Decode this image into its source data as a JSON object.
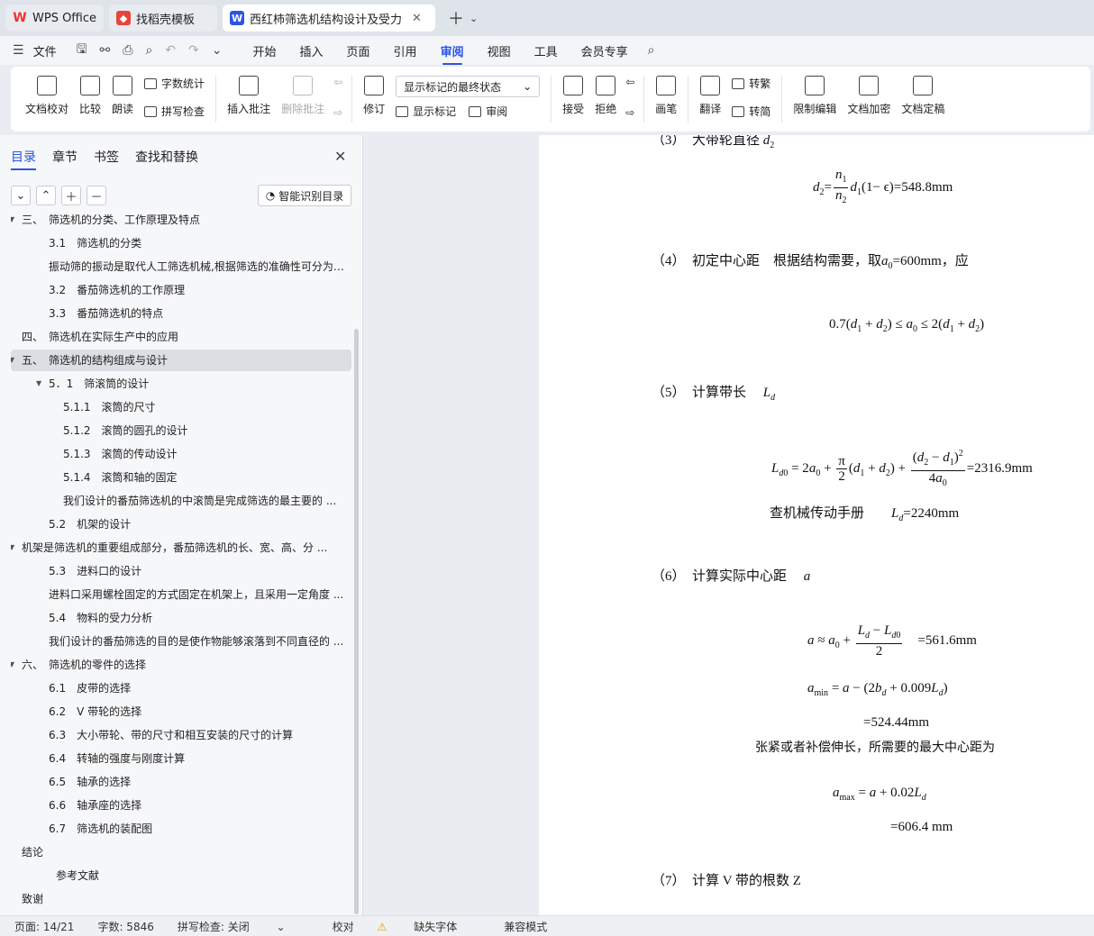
{
  "tabs": [
    {
      "label": "WPS Office",
      "icon": "wps-logo-icon"
    },
    {
      "label": "找稻壳模板",
      "icon": "docer-icon"
    },
    {
      "label": "西红柿筛选机结构设计及受力分",
      "icon": "word-doc-icon",
      "active": true
    }
  ],
  "menu": [
    "文件",
    "开始",
    "插入",
    "页面",
    "引用",
    "审阅",
    "视图",
    "工具",
    "会员专享"
  ],
  "ribbon": {
    "doc_proofread": "文档校对",
    "compare": "比较",
    "read_aloud": "朗读",
    "word_count": "字数统计",
    "spell_check": "拼写检查",
    "insert_comment": "插入批注",
    "delete_comment": "删除批注",
    "revise": "修订",
    "markup_select": "显示标记的最终状态",
    "show_markup": "显示标记",
    "review": "审阅",
    "accept": "接受",
    "reject": "拒绝",
    "pen": "画笔",
    "translate": "翻译",
    "to_traditional": "转繁",
    "to_simplified": "转简",
    "restrict_edit": "限制编辑",
    "encrypt": "文档加密",
    "finalize": "文档定稿"
  },
  "nav": {
    "tabs": [
      "目录",
      "章节",
      "书签",
      "查找和替换"
    ],
    "smart_toc": "智能识别目录",
    "items": [
      {
        "text": "三、　筛选机的分类、工作原理及特点",
        "level": 0,
        "tri": true
      },
      {
        "text": "3.1　筛选机的分类",
        "level": 1
      },
      {
        "text": "振动筛的振动是取代人工筛选机械,根据筛选的准确性可分为 ...",
        "level": 1
      },
      {
        "text": "3.2　番茄筛选机的工作原理",
        "level": 1
      },
      {
        "text": "3.3　番茄筛选机的特点",
        "level": 1
      },
      {
        "text": "四、　筛选机在实际生产中的应用",
        "level": 0
      },
      {
        "text": "五、　筛选机的结构组成与设计",
        "level": 0,
        "tri": true,
        "selected": true
      },
      {
        "text": "5．1　筛滚筒的设计",
        "level": 1,
        "tri": true
      },
      {
        "text": "5.1.1　滚筒的尺寸",
        "level": 2
      },
      {
        "text": "5.1.2　滚筒的圆孔的设计",
        "level": 2
      },
      {
        "text": "5.1.3　滚筒的传动设计",
        "level": 2
      },
      {
        "text": "5.1.4　滚筒和轴的固定",
        "level": 2
      },
      {
        "text": "我们设计的番茄筛选机的中滚筒是完成筛选的最主要的 ...",
        "level": 2
      },
      {
        "text": "5.2　机架的设计",
        "level": 1
      },
      {
        "text": "机架是筛选机的重要组成部分，番茄筛选机的长、宽、高、分 ...",
        "level": 0,
        "tri": true
      },
      {
        "text": "5.3　进料口的设计",
        "level": 1
      },
      {
        "text": "进料口采用螺栓固定的方式固定在机架上，且采用一定角度 ...",
        "level": 1
      },
      {
        "text": "5.4　物料的受力分析",
        "level": 1
      },
      {
        "text": "我们设计的番茄筛选的目的是使作物能够滚落到不同直径的 ...",
        "level": 1
      },
      {
        "text": "六、　筛选机的零件的选择",
        "level": 0,
        "tri": true
      },
      {
        "text": "6.1　皮带的选择",
        "level": 1
      },
      {
        "text": "6.2　V 带轮的选择",
        "level": 1
      },
      {
        "text": "6.3　大小带轮、带的尺寸和相互安装的尺寸的计算",
        "level": 1
      },
      {
        "text": "6.4　转轴的强度与刚度计算",
        "level": 1
      },
      {
        "text": "6.5　轴承的选择",
        "level": 1
      },
      {
        "text": "6.6　轴承座的选择",
        "level": 1
      },
      {
        "text": "6.7　筛选机的装配图",
        "level": 1
      },
      {
        "text": "结论",
        "level": 0
      },
      {
        "text": "参考文献",
        "level": 1.5
      },
      {
        "text": "致谢",
        "level": 0
      }
    ]
  },
  "doc": {
    "l3": "（3）　大带轮直径",
    "eq_d2_result": "=548.8mm",
    "l4": "（4）　初定中心距　根据结构需要，取",
    "l4_val": "=600mm，应",
    "l5": "（5）　计算带长",
    "eq_ld0_result": "=2316.9mm",
    "l5b": "查机械传动手册",
    "l5b_val": "=2240mm",
    "l6": "（6）　计算实际中心距",
    "eq_a_result": "=561.6mm",
    "amin_result": "=524.44mm",
    "l6b": "张紧或者补偿伸长，所需要的最大中心距为",
    "amax_result": "=606.4 mm",
    "l7": "（7）　计算 V 带的根数 Z"
  },
  "status": {
    "page": "页面: 14/21",
    "words": "字数: 5846",
    "spell": "拼写检查: 关闭",
    "proof": "校对",
    "missing_font": "缺失字体",
    "compat": "兼容模式"
  }
}
